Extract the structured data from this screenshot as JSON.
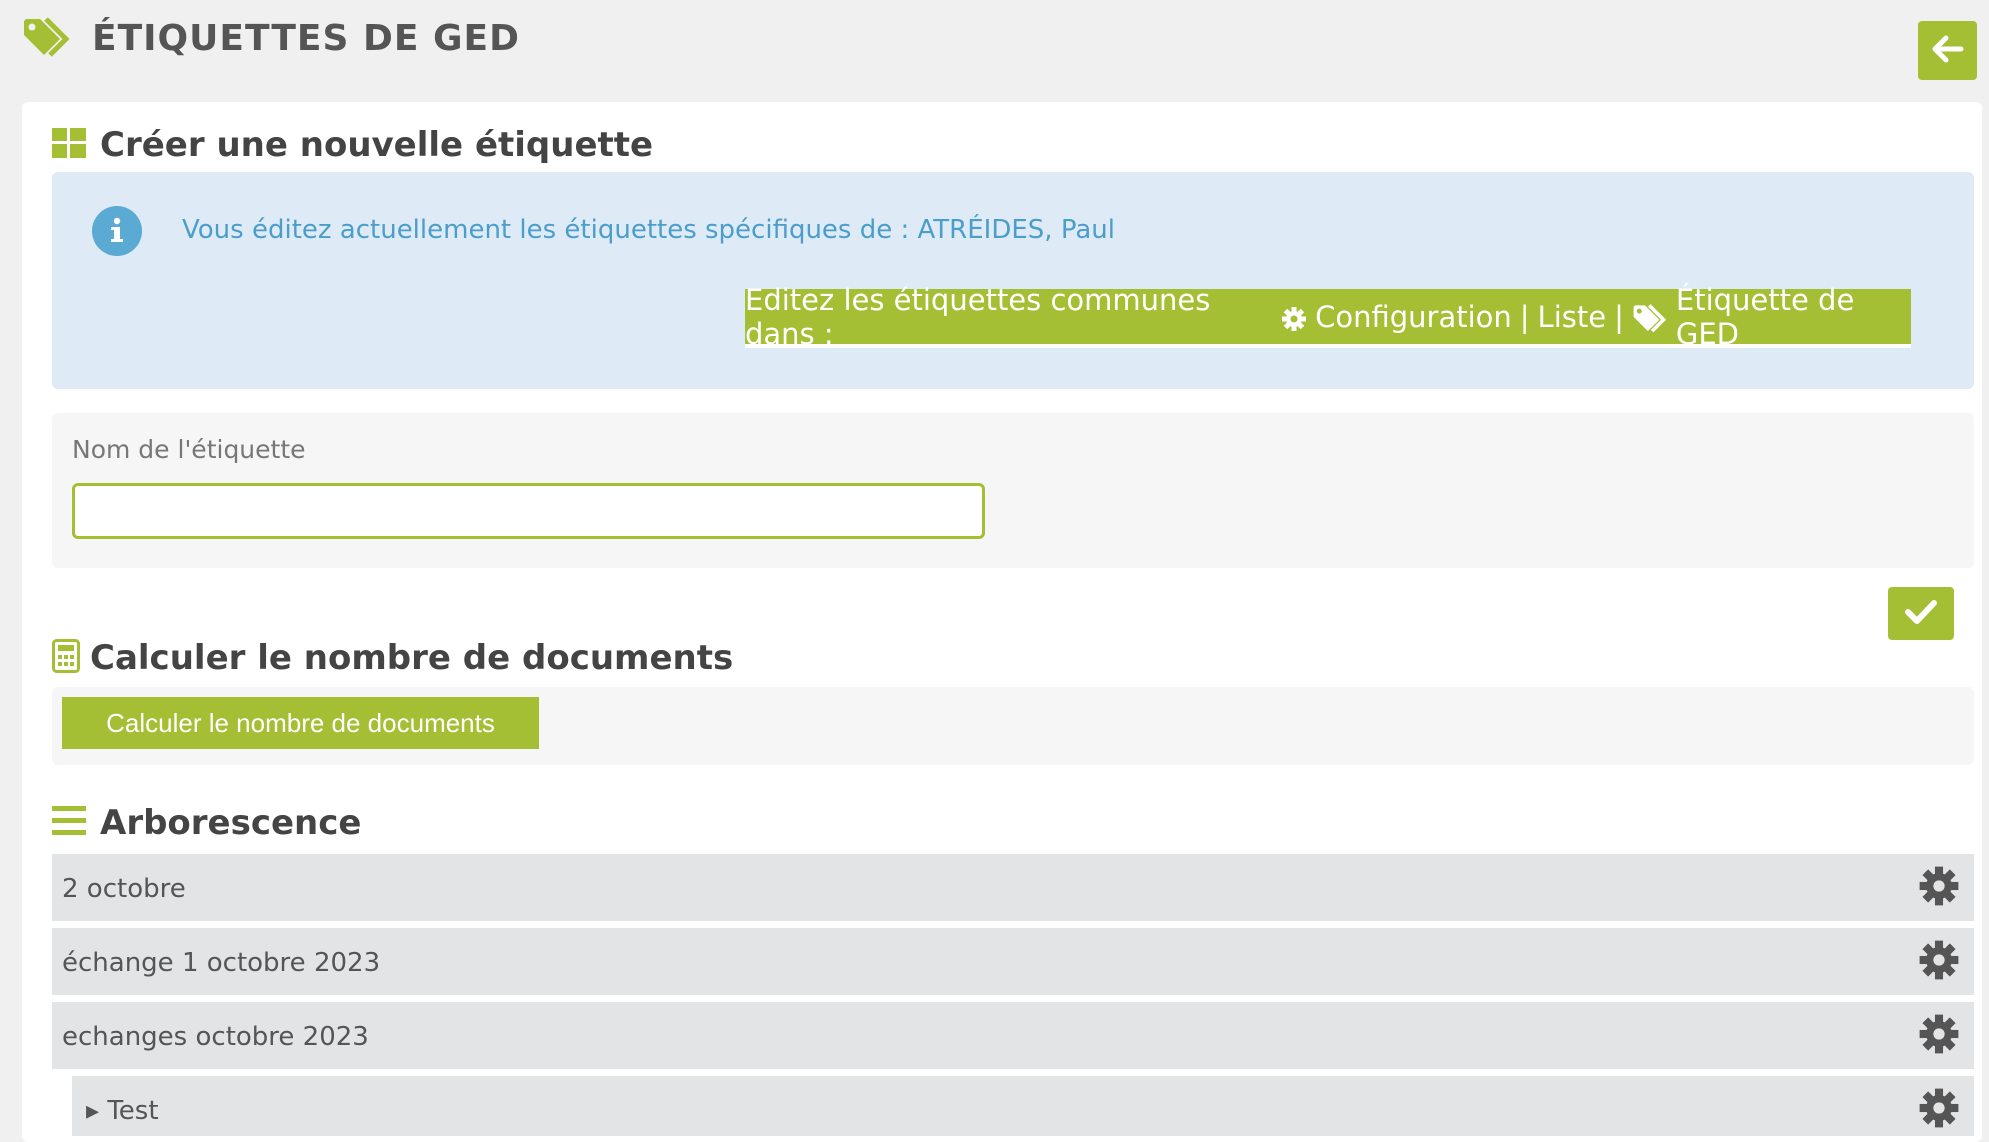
{
  "page": {
    "title": "ÉTIQUETTES DE GED",
    "title_icon": "tags-icon"
  },
  "header": {
    "back_icon": "arrow-left-icon"
  },
  "create_section": {
    "title": "Créer une nouvelle étiquette",
    "icon": "grid-icon",
    "info_icon": "info-circle-icon",
    "info_text": "Vous éditez actuellement les étiquettes spécifiques de : ATRÉIDES, Paul",
    "common_button": {
      "prefix": "Editez les étiquettes communes dans :",
      "config_icon": "cog-icon",
      "part1": "Configuration",
      "sep1": "|",
      "part2": "Liste",
      "sep2": "|",
      "tag_icon": "tags-icon",
      "part3": "Étiquette de GED"
    },
    "form": {
      "label": "Nom de l'étiquette",
      "value": "",
      "placeholder": ""
    },
    "confirm_icon": "check-icon"
  },
  "calc_section": {
    "title": "Calculer le nombre de documents",
    "icon": "calculator-icon",
    "button_label": "Calculer le nombre de documents"
  },
  "tree_section": {
    "title": "Arborescence",
    "icon": "list-icon",
    "items": [
      {
        "label": "2 octobre"
      },
      {
        "label": "échange 1 octobre 2023"
      },
      {
        "label": "echanges octobre 2023"
      },
      {
        "label": "▸ Test"
      }
    ]
  },
  "colors": {
    "accent": "#a4bf34",
    "info_bg": "#deebf6",
    "info_text": "#4a9ec9",
    "row_bg": "#e3e4e6"
  }
}
